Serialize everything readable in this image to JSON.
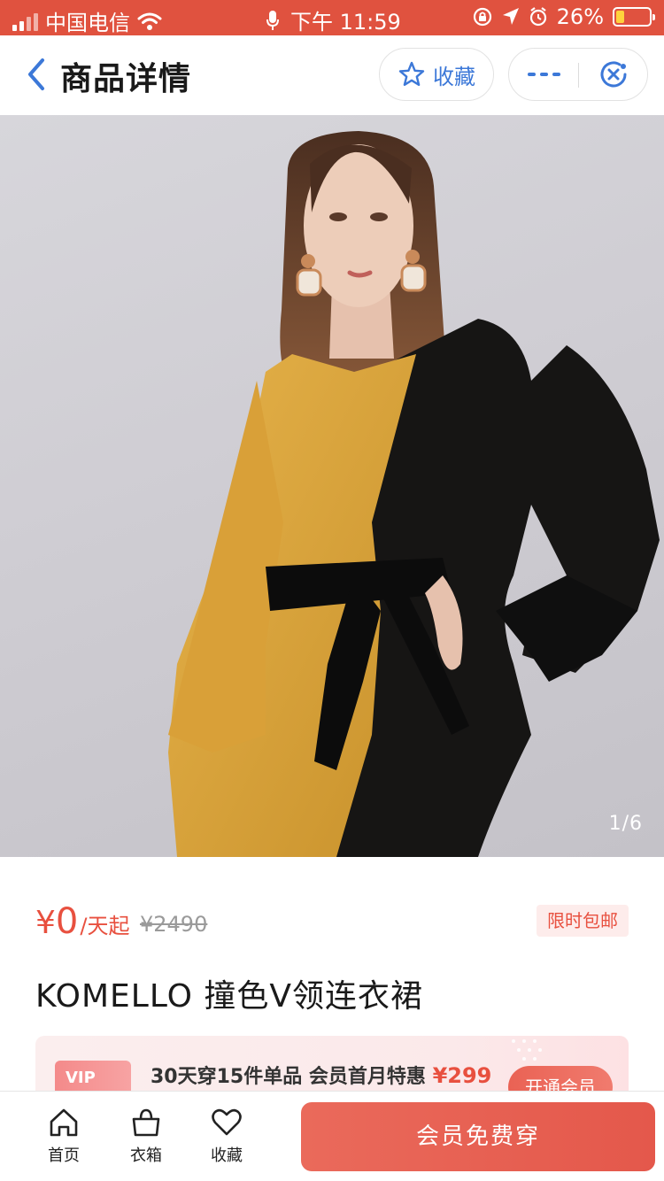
{
  "status_bar": {
    "carrier": "中国电信",
    "time": "下午 11:59",
    "battery_percent": "26%",
    "battery_level": 0.26,
    "icons": [
      "signal-icon",
      "wifi-icon",
      "mic-icon",
      "rotation-lock-icon",
      "location-icon",
      "alarm-icon",
      "battery-icon"
    ]
  },
  "nav": {
    "title": "商品详情",
    "favorite_label": "收藏",
    "colors": {
      "accent": "#3c78d8"
    }
  },
  "gallery": {
    "counter": "1/6",
    "current": 1,
    "total": 6
  },
  "price": {
    "currency": "¥",
    "amount": "0",
    "unit": "/天起",
    "original": "¥2490",
    "promo_badge": "限时包邮",
    "color": "#e8503f"
  },
  "product": {
    "title": "KOMELLO 撞色V领连衣裙"
  },
  "vip": {
    "tag": "VIP",
    "text": "30天穿15件单品  会员首月特惠",
    "price": "¥299",
    "open_button": "开通会员"
  },
  "bottom_bar": {
    "tabs": [
      {
        "label": "首页",
        "icon": "home-icon"
      },
      {
        "label": "衣箱",
        "icon": "bag-icon"
      },
      {
        "label": "收藏",
        "icon": "heart-icon"
      }
    ],
    "cta": "会员免费穿"
  }
}
